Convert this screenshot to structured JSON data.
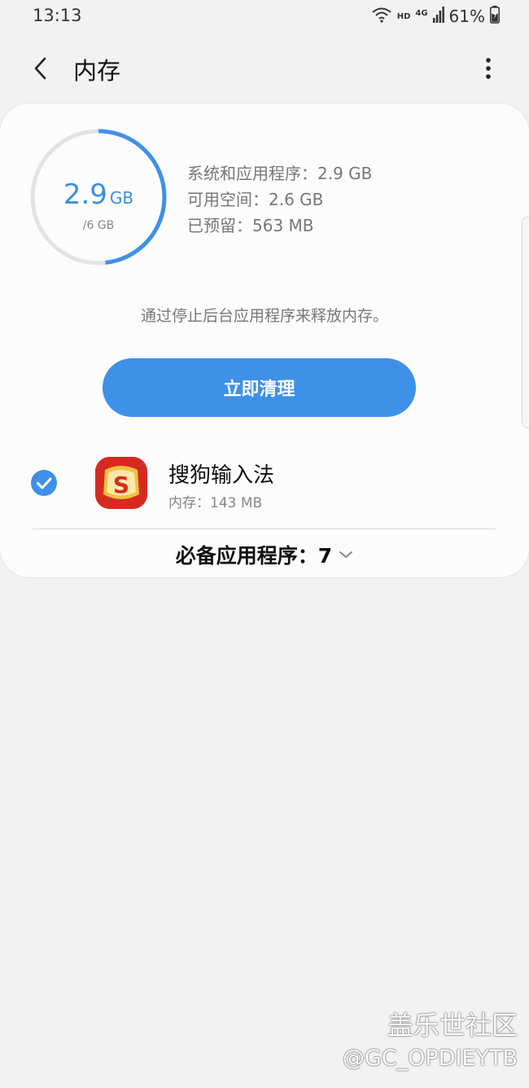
{
  "status_bar": {
    "time": "13:13",
    "hd": "HD",
    "network": "4G",
    "battery": "61%",
    "icons": [
      "wifi-icon",
      "signal-icon",
      "battery-icon"
    ]
  },
  "app_bar": {
    "title": "内存",
    "back_icon": "chevron-left-icon",
    "more_icon": "more-vertical-icon"
  },
  "memory": {
    "used_value": "2.9",
    "used_unit": "GB",
    "total": "/6 GB",
    "usage_fraction": 0.483,
    "stats": [
      "系统和应用程序：2.9 GB",
      "可用空间：2.6 GB",
      "已预留：563 MB"
    ],
    "hint": "通过停止后台应用程序来释放内存。"
  },
  "clean_button_label": "立即清理",
  "apps": [
    {
      "name": "搜狗输入法",
      "memory": "内存：143 MB",
      "checked": true,
      "icon_glyph": "S"
    }
  ],
  "essential_apps_label": "必备应用程序：7",
  "watermark": {
    "line1": "盖乐世社区",
    "line2": "@GC_OPDIEYTB"
  },
  "colors": {
    "accent": "#3f90e8",
    "gauge_track": "#e3e3e3",
    "icon_red": "#d62a20"
  }
}
